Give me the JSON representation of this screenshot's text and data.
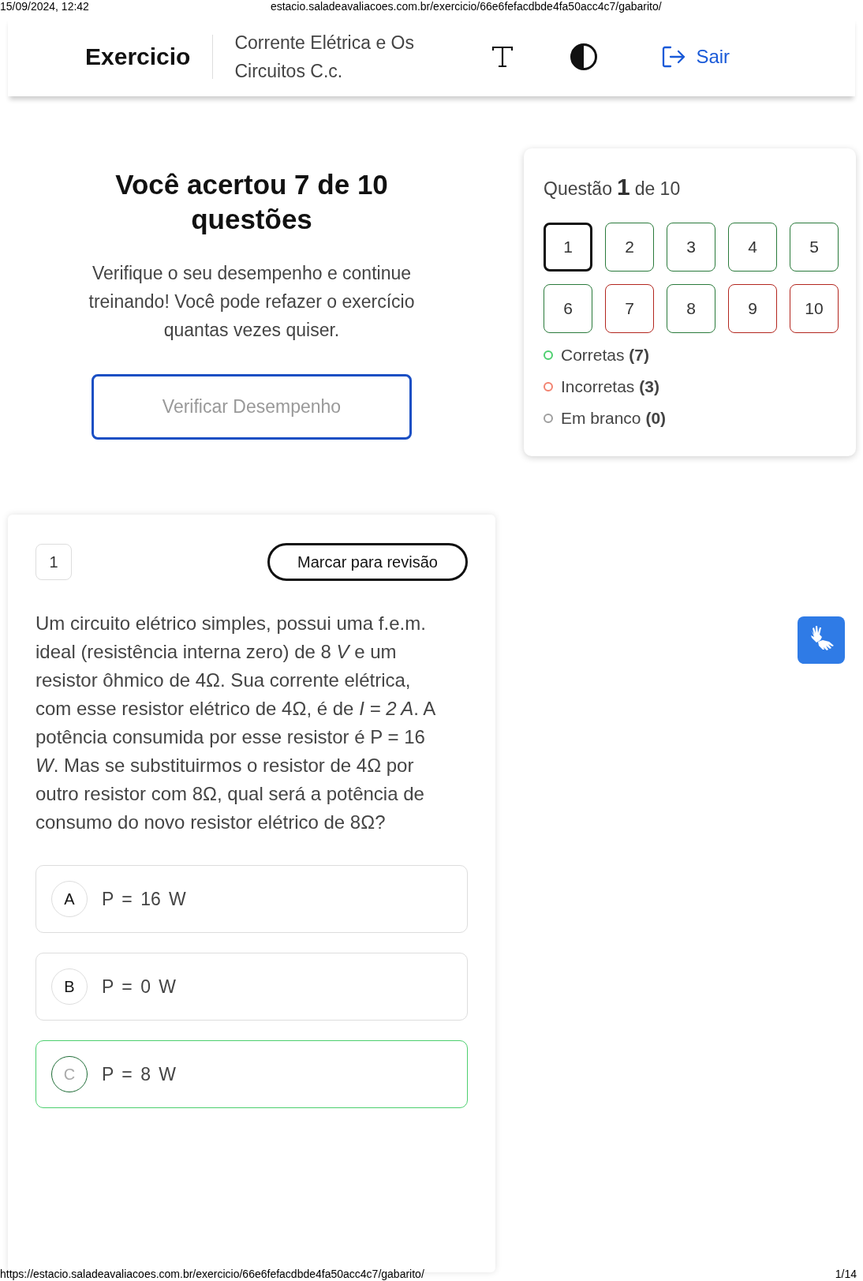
{
  "print_header": {
    "date": "15/09/2024, 12:42",
    "url": "estacio.saladeavaliacoes.com.br/exercicio/66e6fefacdbde4fa50acc4c7/gabarito/"
  },
  "topbar": {
    "title": "Exercicio",
    "subject_lines": [
      "Corrente Elétrica e Os",
      "Circuitos C.c."
    ],
    "logout": "Sair"
  },
  "result": {
    "title": "Você acertou 7 de 10 questões",
    "message": "Verifique o seu desempenho e continue treinando! Você pode refazer o exercício quantas vezes quiser.",
    "button": "Verificar Desempenho"
  },
  "navigator": {
    "label_before": "Questão",
    "current": "1",
    "label_after": "de 10",
    "questions": [
      {
        "number": "1",
        "correct": true,
        "selected": true
      },
      {
        "number": "2",
        "correct": true,
        "selected": false
      },
      {
        "number": "3",
        "correct": true,
        "selected": false
      },
      {
        "number": "4",
        "correct": true,
        "selected": false
      },
      {
        "number": "5",
        "correct": true,
        "selected": false
      },
      {
        "number": "6",
        "correct": true,
        "selected": false
      },
      {
        "number": "7",
        "correct": false,
        "selected": false
      },
      {
        "number": "8",
        "correct": true,
        "selected": false
      },
      {
        "number": "9",
        "correct": false,
        "selected": false
      },
      {
        "number": "10",
        "correct": false,
        "selected": false
      }
    ],
    "legend": [
      {
        "label": "Corretas **(7)**",
        "color": "#4ccf6e"
      },
      {
        "label": "Incorretas **(3)**",
        "color": "#f2826f"
      },
      {
        "label": "Em branco **(0)**",
        "color": "#9e9e9e"
      }
    ]
  },
  "question": {
    "number": "1",
    "review_button": "Marcar para revisão",
    "text": "Um circuito elétrico simples, possui uma f.e.m. ideal (resistência interna zero) de 8 *V* e um resistor ôhmico de 4Ω. Sua corrente elétrica, com esse resistor elétrico de 4Ω, é de *I = 2 A*. A potência consumida por esse resistor é P = 16 *W*. Mas se substituirmos o resistor de 4Ω por outro resistor com 8Ω, qual será a potência de consumo do novo resistor elétrico de 8Ω?",
    "options": [
      {
        "letter": "A",
        "text": "P = 16 W",
        "correct": false
      },
      {
        "letter": "B",
        "text": "P = 0 W",
        "correct": false
      },
      {
        "letter": "C",
        "text": "P = 8 W",
        "correct": true
      }
    ]
  },
  "print_footer": {
    "url": "https://estacio.saladeavaliacoes.com.br/exercicio/66e6fefacdbde4fa50acc4c7/gabarito/",
    "page": "1/14"
  }
}
